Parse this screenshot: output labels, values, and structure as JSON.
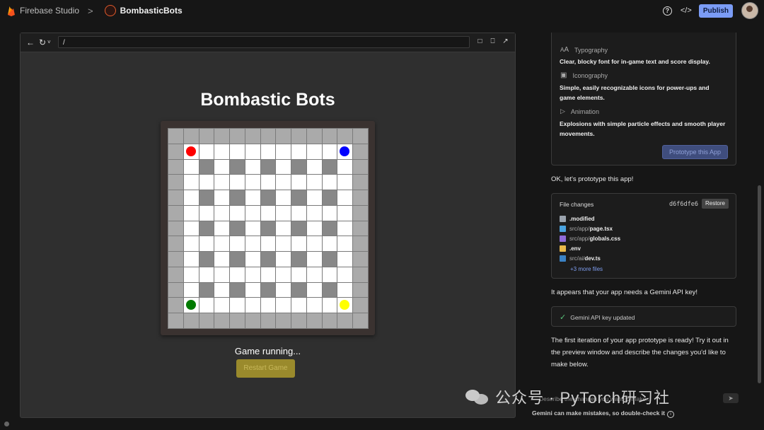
{
  "topbar": {
    "product": "Firebase Studio",
    "separator": ">",
    "project_name": "BombasticBots",
    "publish_label": "Publish"
  },
  "preview": {
    "url": "/",
    "game_title": "Bombastic Bots",
    "status_text": "Game running...",
    "restart_label": "Restart Game",
    "board": {
      "rows": [
        "wwwwwwwwwwwww",
        "wReeeeeeeeeBw",
        "webebebebebew",
        "weeeeeeeeeeew",
        "webebebebebew",
        "weeeeeeeeeeew",
        "webebebebebew",
        "weeeeeeeeeeew",
        "webebebebebew",
        "weeeeeeeeeeew",
        "webebebebebew",
        "wGeeeeeeeeeYw",
        "wwwwwwwwwwwww"
      ],
      "bot_colors": {
        "R": "#ff0000",
        "B": "#0000ff",
        "G": "#007a00",
        "Y": "#ffff00"
      }
    }
  },
  "chat": {
    "guidelines": [
      {
        "icon": "typography-icon",
        "heading": "Typography",
        "text": "Clear, blocky font for in-game text and score display."
      },
      {
        "icon": "iconography-icon",
        "heading": "Iconography",
        "text": "Simple, easily recognizable icons for power-ups and game elements."
      },
      {
        "icon": "animation-icon",
        "heading": "Animation",
        "text": "Explosions with simple particle effects and smooth player movements."
      }
    ],
    "prototype_button": "Prototype this App",
    "msg_prototype": "OK, let's prototype this app!",
    "file_changes": {
      "title": "File changes",
      "hash": "d6f6dfe6",
      "restore_label": "Restore",
      "files": [
        {
          "dir": "",
          "name": ".modified",
          "icon_color": "#9aa3ad"
        },
        {
          "dir": "src/app/",
          "name": "page.tsx",
          "icon_color": "#4aa3df"
        },
        {
          "dir": "src/app/",
          "name": "globals.css",
          "icon_color": "#8e6bd8"
        },
        {
          "dir": "",
          "name": ".env",
          "icon_color": "#e8b84a"
        },
        {
          "dir": "src/ai/",
          "name": "dev.ts",
          "icon_color": "#3b82c4"
        }
      ],
      "more": "+3 more files"
    },
    "msg_api": "It appears that your app needs a Gemini API key!",
    "api_status": "Gemini API key updated",
    "msg_ready": "The first iteration of your app prototype is ready! Try it out in the preview window and describe the changes you'd like to make below.",
    "input_placeholder": "Describe the changes you want to make...",
    "disclaimer": "Gemini can make mistakes, so double-check it"
  },
  "watermark": {
    "text": "公众号 · PyTorch研习社"
  }
}
